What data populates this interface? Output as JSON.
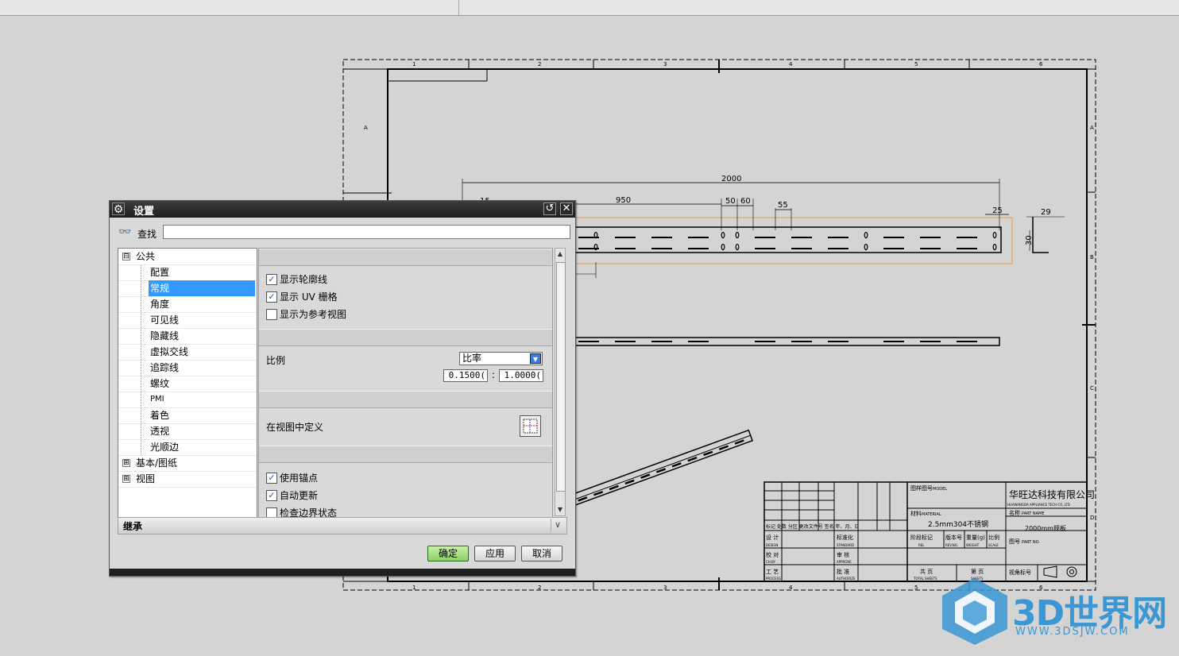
{
  "dialog": {
    "title": "设置",
    "search_label": "查找",
    "search_value": "",
    "tree": [
      {
        "label": "公共",
        "expander": "⊟"
      },
      {
        "label": "配置"
      },
      {
        "label": "常规",
        "selected": true
      },
      {
        "label": "角度"
      },
      {
        "label": "可见线"
      },
      {
        "label": "隐藏线"
      },
      {
        "label": "虚拟交线"
      },
      {
        "label": "追踪线"
      },
      {
        "label": "螺纹"
      },
      {
        "label": "PMI"
      },
      {
        "label": "着色"
      },
      {
        "label": "透视"
      },
      {
        "label": "光顺边"
      },
      {
        "label": "基本/图纸",
        "expander": "⊞"
      },
      {
        "label": "视图",
        "expander": "⊞"
      }
    ],
    "options": {
      "show_silhouette": {
        "label": "显示轮廓线",
        "checked": true
      },
      "show_uv_grid": {
        "label": "显示 UV 栅格",
        "checked": true
      },
      "show_as_reference": {
        "label": "显示为参考视图",
        "checked": false
      },
      "scale_label": "比例",
      "scale_mode": "比率",
      "scale_numerator": "0.1500(",
      "scale_colon": ":",
      "scale_denominator": "1.0000(",
      "define_in_view_label": "在视图中定义",
      "use_anchor": {
        "label": "使用锚点",
        "checked": true
      },
      "auto_update": {
        "label": "自动更新",
        "checked": true
      },
      "check_boundary": {
        "label": "检查边界状态",
        "checked": false
      }
    },
    "inherit_label": "继承",
    "buttons": {
      "ok": "确定",
      "apply": "应用",
      "cancel": "取消"
    }
  },
  "drawing": {
    "dims": {
      "total": "2000",
      "d950": "950",
      "d50": "50",
      "d60": "60",
      "d55": "55",
      "d25": "25",
      "d15": "15",
      "d29": "29",
      "d30": "30"
    },
    "zone_cols": [
      "1",
      "2",
      "3",
      "4",
      "5",
      "6"
    ],
    "zone_rows": [
      "A",
      "B",
      "C",
      "D"
    ],
    "title_block": {
      "company": "华旺达科技有限公司",
      "company_en": "HUAWANGDA APPLIANCE TECH CO.,LTD",
      "model_label": "图样图号",
      "model_en": "MODEL",
      "material_label": "材料",
      "material_en": "MATERIAL",
      "material_value": "2.5mm304不锈钢",
      "part_name_label": "名称",
      "part_name_en": "PART NAME",
      "part_name_value": "2000mm规板",
      "part_no_label": "图号",
      "part_no_en": "PART NO.",
      "design": "设 计",
      "design_en": "DESIGN",
      "check": "校 对",
      "check_en": "CH.BY",
      "process": "工 艺",
      "process_en": "PROCESS",
      "standard": "标准化",
      "standard_en": "STANDARD",
      "approve": "审 核",
      "approve_en": "APPROVE",
      "authorize": "批 准",
      "authorize_en": "AUTHORIZE",
      "rel": "阶段标记",
      "rel_en": "REL",
      "rev": "版本号",
      "rev_en": "REV.NO.",
      "weight": "重量(g)",
      "weight_en": "WEIGHT",
      "scale": "比例",
      "scale_en": "SCALE",
      "total_sheets": "共 页",
      "total_sheets_en": "TOTAL SHEETS",
      "sheet": "第 页",
      "sheet_en": "SHEETS",
      "projection": "视角标号",
      "rev_cols": "标记 处数 分区 更改文件号 签名 年、月、日"
    }
  },
  "watermark": {
    "text": "3D世界网",
    "url": "WWW.3DSJW.COM"
  },
  "colors": {
    "selection": "#3399ff",
    "ok_button": "#8fd067",
    "highlight_outline": "#e8a040",
    "logo": "#3a97d4"
  }
}
